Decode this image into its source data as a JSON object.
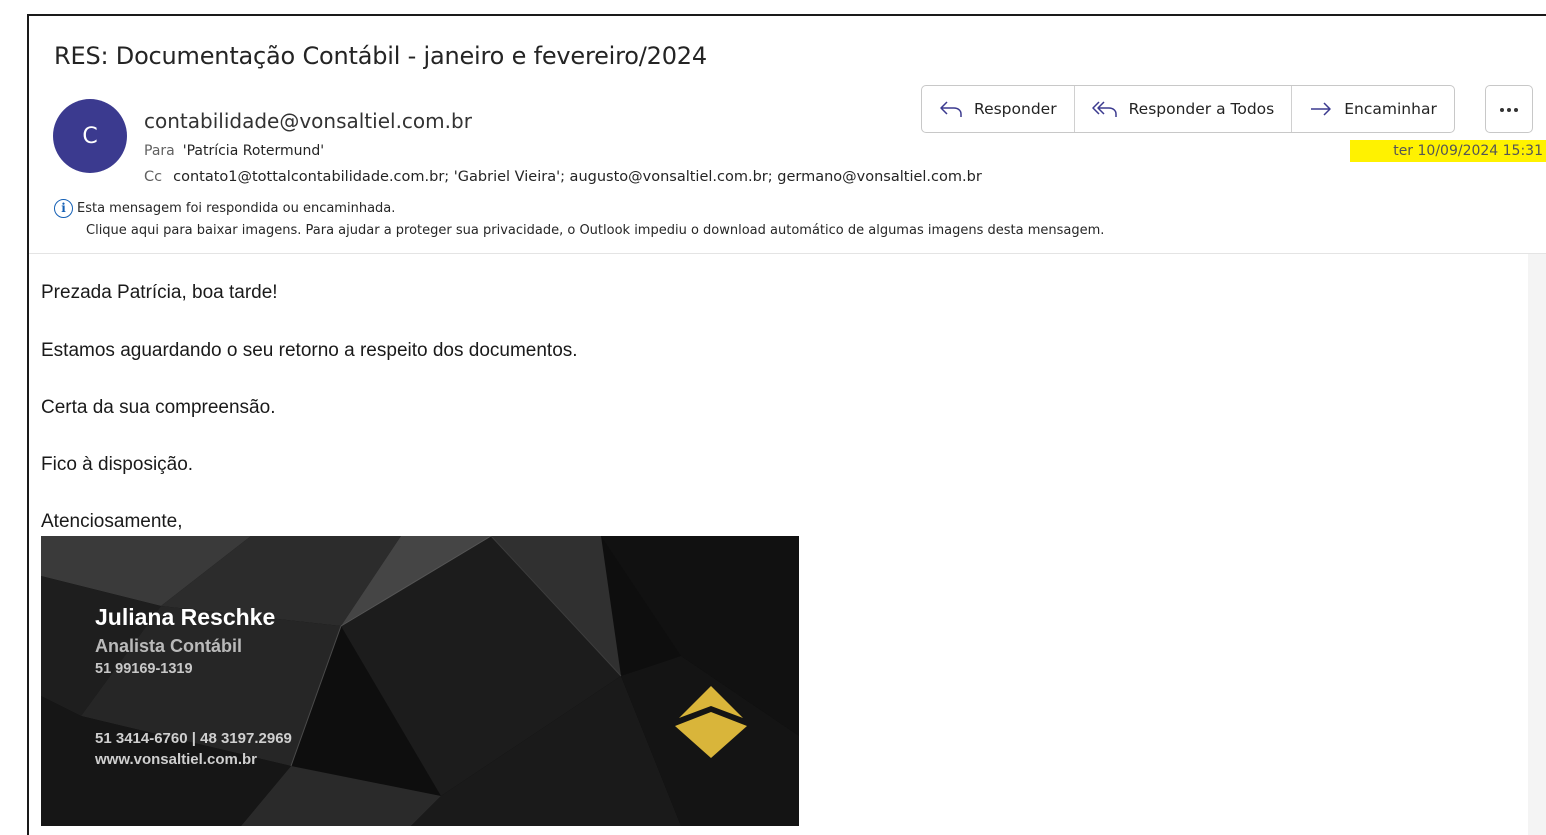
{
  "email": {
    "subject": "RES: Documentação Contábil - janeiro e fevereiro/2024",
    "avatar_initial": "C",
    "sender": "contabilidade@vonsaltiel.com.br",
    "to_label": "Para",
    "to_value": "'Patrícia Rotermund'",
    "cc_label": "Cc",
    "cc_value": "contato1@tottalcontabilidade.com.br; 'Gabriel Vieira'; augusto@vonsaltiel.com.br; germano@vonsaltiel.com.br",
    "date": "ter 10/09/2024 15:31",
    "info_line1": "Esta mensagem foi respondida ou encaminhada.",
    "info_line2": "Clique aqui para baixar imagens. Para ajudar a proteger sua privacidade, o Outlook impediu o download automático de algumas imagens desta mensagem."
  },
  "actions": {
    "reply": "Responder",
    "reply_all": "Responder a Todos",
    "forward": "Encaminhar",
    "more_icon": "more-horizontal-icon"
  },
  "body": {
    "greeting": "Prezada Patrícia, boa tarde!",
    "line1": "Estamos aguardando o seu retorno a respeito dos documentos.",
    "line2": "Certa da sua compreensão.",
    "line3": "Fico à disposição.",
    "closing": "Atenciosamente,"
  },
  "signature": {
    "name": "Juliana Reschke",
    "role": "Analista Contábil",
    "cell": "51 99169-1319",
    "phones": "51 3414-6760  | 48 3197.2969",
    "website": "www.vonsaltiel.com.br"
  },
  "colors": {
    "avatar": "#3b3a8f",
    "date_highlight": "#fff200",
    "info_icon": "#1560b5",
    "logo_gold": "#d9b53a"
  }
}
